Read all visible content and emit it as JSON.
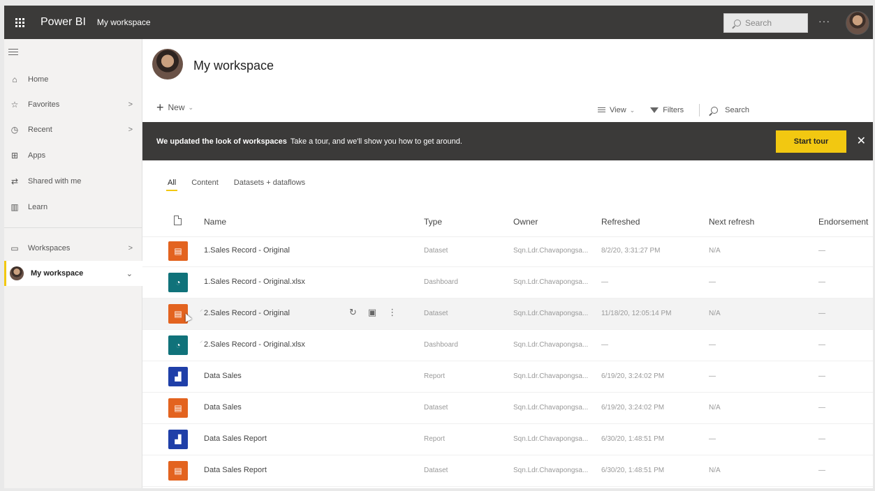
{
  "topbar": {
    "brand": "Power BI",
    "breadcrumb": "My workspace",
    "search_placeholder": "Search",
    "more": "···"
  },
  "sidebar": {
    "items": [
      {
        "label": "Home",
        "icon": "home-icon"
      },
      {
        "label": "Favorites",
        "icon": "star-icon",
        "chevron": ">"
      },
      {
        "label": "Recent",
        "icon": "clock-icon",
        "chevron": ">"
      },
      {
        "label": "Apps",
        "icon": "apps-icon"
      },
      {
        "label": "Shared with me",
        "icon": "share-icon"
      },
      {
        "label": "Learn",
        "icon": "book-icon"
      },
      {
        "label": "Workspaces",
        "icon": "workspaces-icon",
        "chevron": ">"
      },
      {
        "label": "My workspace",
        "icon": "avatar",
        "chevron": "⌄"
      }
    ]
  },
  "workspace": {
    "title": "My workspace",
    "new_label": "New",
    "view_label": "View",
    "filters_label": "Filters",
    "search_label": "Search"
  },
  "banner": {
    "bold": "We updated the look of workspaces",
    "text": "Take a tour, and we'll show you how to get around.",
    "button": "Start tour",
    "close": "✕"
  },
  "tabs": [
    "All",
    "Content",
    "Datasets + dataflows"
  ],
  "table": {
    "columns": [
      "Name",
      "Type",
      "Owner",
      "Refreshed",
      "Next refresh",
      "Endorsement"
    ],
    "rows": [
      {
        "icon": "dataset",
        "name": "1.Sales Record - Original",
        "type": "Dataset",
        "owner": "Sqn.Ldr.Chavapongsa...",
        "refreshed": "8/2/20, 3:31:27 PM",
        "next": "N/A",
        "endorsement": "—"
      },
      {
        "icon": "dashboard",
        "name": "1.Sales Record - Original.xlsx",
        "type": "Dashboard",
        "owner": "Sqn.Ldr.Chavapongsa...",
        "refreshed": "—",
        "next": "—",
        "endorsement": "—"
      },
      {
        "icon": "dataset",
        "name": "2.Sales Record - Original",
        "type": "Dataset",
        "owner": "Sqn.Ldr.Chavapongsa...",
        "refreshed": "11/18/20, 12:05:14 PM",
        "next": "N/A",
        "endorsement": "—"
      },
      {
        "icon": "dashboard",
        "name": "2.Sales Record - Original.xlsx",
        "type": "Dashboard",
        "owner": "Sqn.Ldr.Chavapongsa...",
        "refreshed": "—",
        "next": "—",
        "endorsement": "—"
      },
      {
        "icon": "report",
        "name": "Data Sales",
        "type": "Report",
        "owner": "Sqn.Ldr.Chavapongsa...",
        "refreshed": "6/19/20, 3:24:02 PM",
        "next": "—",
        "endorsement": "—"
      },
      {
        "icon": "dataset",
        "name": "Data Sales",
        "type": "Dataset",
        "owner": "Sqn.Ldr.Chavapongsa...",
        "refreshed": "6/19/20, 3:24:02 PM",
        "next": "N/A",
        "endorsement": "—"
      },
      {
        "icon": "report",
        "name": "Data Sales Report",
        "type": "Report",
        "owner": "Sqn.Ldr.Chavapongsa...",
        "refreshed": "6/30/20, 1:48:51 PM",
        "next": "—",
        "endorsement": "—"
      },
      {
        "icon": "dataset",
        "name": "Data Sales Report",
        "type": "Dataset",
        "owner": "Sqn.Ldr.Chavapongsa...",
        "refreshed": "6/30/20, 1:48:51 PM",
        "next": "N/A",
        "endorsement": "—"
      }
    ]
  },
  "colors": {
    "topbar": "#3b3a39",
    "accent": "#f2c811",
    "dataset": "#e3631f",
    "dashboard": "#10727a",
    "report": "#1f3fa8"
  }
}
